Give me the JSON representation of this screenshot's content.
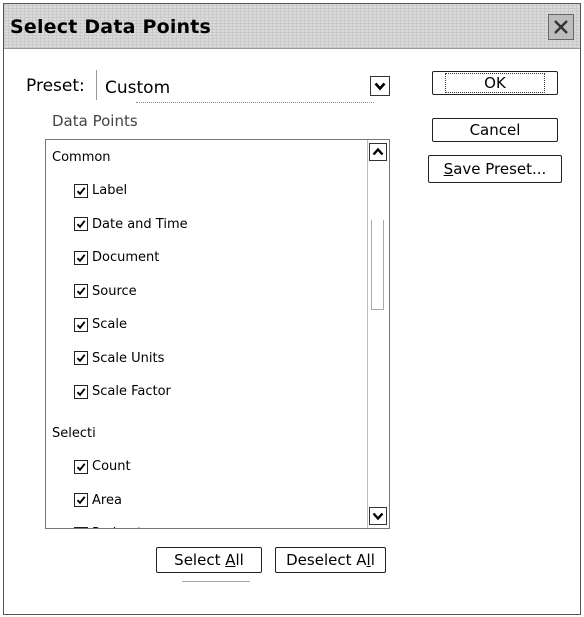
{
  "window": {
    "title": "Select Data Points"
  },
  "preset": {
    "label": "Preset:",
    "value": "Custom"
  },
  "data_points": {
    "group_label": "Data Points",
    "sections": [
      {
        "name": "Common",
        "items": [
          {
            "label": "Label",
            "checked": true
          },
          {
            "label": "Date and Time",
            "checked": true
          },
          {
            "label": "Document",
            "checked": true
          },
          {
            "label": "Source",
            "checked": true
          },
          {
            "label": "Scale",
            "checked": true
          },
          {
            "label": "Scale Units",
            "checked": true
          },
          {
            "label": "Scale Factor",
            "checked": true
          }
        ]
      },
      {
        "name": "Selecti",
        "items": [
          {
            "label": "Count",
            "checked": true
          },
          {
            "label": "Area",
            "checked": true
          },
          {
            "label": "Perimeter",
            "checked": false
          }
        ]
      }
    ]
  },
  "buttons": {
    "ok": "OK",
    "cancel": "Cancel",
    "save_preset": {
      "pre": "",
      "accel": "S",
      "post": "ave Preset..."
    },
    "select_all": {
      "pre": "Select ",
      "accel": "A",
      "post": "ll"
    },
    "deselect_all": {
      "pre": "Deselect A",
      "accel": "l",
      "post": "l"
    }
  },
  "icons": {
    "close": "close-icon",
    "dropdown": "chevron-down-icon",
    "scroll_up": "chevron-up-icon",
    "scroll_down": "chevron-down-icon",
    "check": "checkmark-icon"
  }
}
